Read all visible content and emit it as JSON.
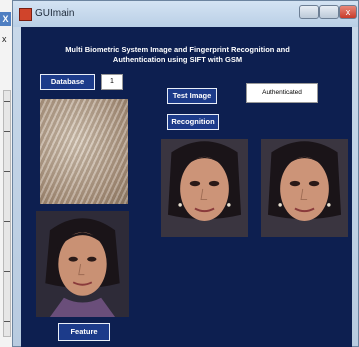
{
  "background_window": {
    "close_glyph": "X",
    "x_glyph": "x"
  },
  "window": {
    "title": "GUImain",
    "icon": "app-icon",
    "controls": {
      "minimize_glyph": "",
      "maximize_glyph": "",
      "close_glyph": "x"
    }
  },
  "main": {
    "heading_line1": "Multi Biometric System Image and Fingerprint Recognition and",
    "heading_line2": "Authentication using SIFT with GSM",
    "database_label": "Database",
    "database_value": "1",
    "test_image_label": "Test Image",
    "recognition_label": "Recognition",
    "status_text": "Authenticated",
    "feature_label": "Feature"
  },
  "colors": {
    "panel_background": "#0d1f50",
    "button_background": "#1c3b8a"
  }
}
